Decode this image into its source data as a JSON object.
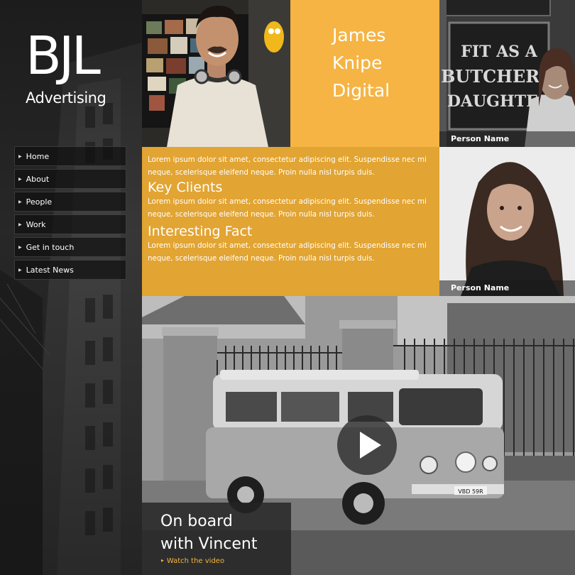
{
  "brand": {
    "logo": "BJL",
    "subtitle": "Advertising"
  },
  "nav": {
    "items": [
      {
        "label": "Home"
      },
      {
        "label": "About"
      },
      {
        "label": "People"
      },
      {
        "label": "Work"
      },
      {
        "label": "Get in touch"
      },
      {
        "label": "Latest News"
      }
    ]
  },
  "feature": {
    "name_lines": [
      "James",
      "Knipe",
      "Digital"
    ]
  },
  "people": [
    {
      "caption": "Person Name",
      "sign_lines": [
        "FIT AS A",
        "BUTCHER'S",
        "DAUGHTER"
      ]
    },
    {
      "caption": "Person Name"
    }
  ],
  "info": {
    "intro": "Lorem ipsum dolor sit amet, consectetur adipiscing elit. Suspendisse nec mi neque, scelerisque eleifend neque. Proin nulla nisl turpis duis.",
    "sections": [
      {
        "heading": "Key Clients",
        "body": "Lorem ipsum dolor sit amet, consectetur adipiscing elit. Suspendisse nec mi neque, scelerisque eleifend neque. Proin nulla nisl turpis duis."
      },
      {
        "heading": "Interesting Fact",
        "body": "Lorem ipsum dolor sit amet, consectetur adipiscing elit. Suspendisse nec mi neque, scelerisque eleifend neque. Proin nulla nisl turpis duis."
      }
    ]
  },
  "video": {
    "title_lines": [
      "On board",
      "with Vincent"
    ],
    "link": "Watch the video",
    "plate": "VBD 59R"
  },
  "colors": {
    "accent": "#f5b443",
    "accent_dark": "#e2a432",
    "sidebar": "#2b2b2b"
  }
}
